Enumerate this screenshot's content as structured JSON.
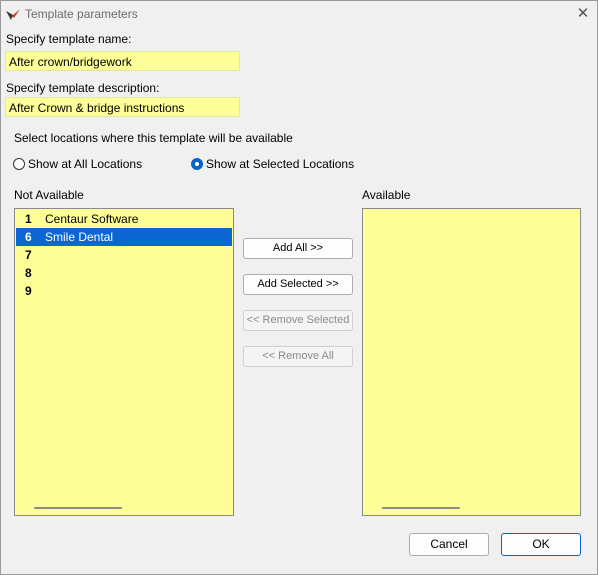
{
  "window": {
    "title": "Template parameters",
    "close_glyph": "✕"
  },
  "form": {
    "name_label": "Specify template name:",
    "name_value": "After crown/bridgework",
    "desc_label": "Specify template description:",
    "desc_value": "After Crown & bridge instructions",
    "locations_label": "Select locations where this template will be available",
    "radio_all": "Show at All Locations",
    "radio_selected": "Show at Selected Locations",
    "radio_selected_checked": true
  },
  "lists": {
    "not_available_label": "Not Available",
    "available_label": "Available",
    "not_available_items": [
      {
        "num": "1",
        "name": "Centaur Software",
        "selected": false
      },
      {
        "num": "6",
        "name": "Smile Dental",
        "selected": true
      },
      {
        "num": "7",
        "name": "",
        "selected": false
      },
      {
        "num": "8",
        "name": "",
        "selected": false
      },
      {
        "num": "9",
        "name": "",
        "selected": false
      }
    ],
    "available_items": []
  },
  "buttons": {
    "add_all": "Add All >>",
    "add_selected": "Add Selected >>",
    "remove_selected": "<< Remove Selected",
    "remove_all": "<< Remove All",
    "cancel": "Cancel",
    "ok": "OK"
  },
  "colors": {
    "field_bg": "#ffff99",
    "selection": "#0a66d2",
    "accent": "#0a64c8"
  },
  "icons": {
    "app": "app-logo-icon",
    "close": "close-icon"
  }
}
